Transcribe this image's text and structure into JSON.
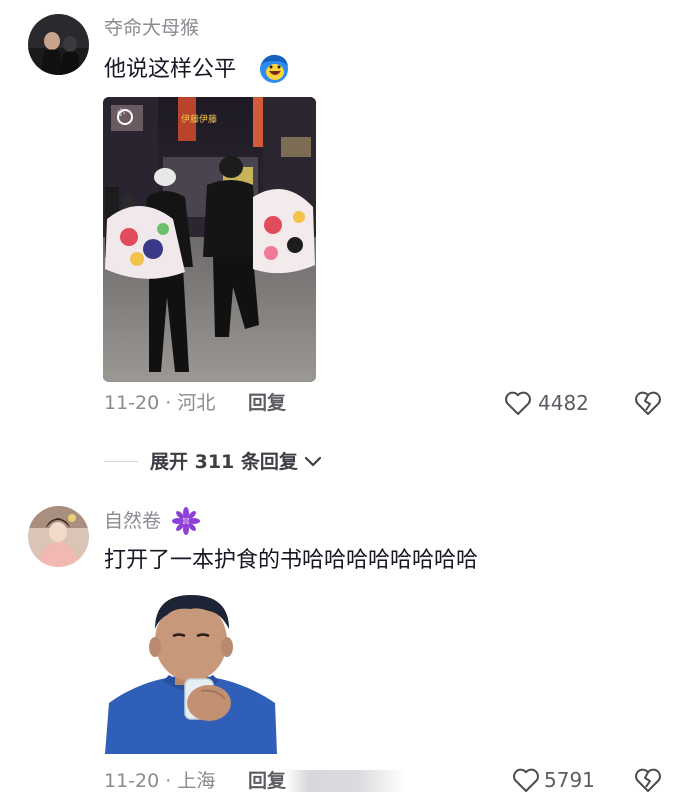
{
  "comments": [
    {
      "username": "夺命大母猴",
      "text": "他说这样公平",
      "date_location": "11-20 · 河北",
      "reply_label": "回复",
      "like_count": "4482"
    },
    {
      "username": "自然卷",
      "text": "打开了一本护食的书哈哈哈哈哈哈哈哈",
      "date_location": "11-20 · 上海",
      "reply_label": "回复",
      "like_count": "5791"
    }
  ],
  "expand_replies": {
    "label": "展开 311 条回复"
  },
  "photo_signs": {
    "sign_1": "伊藤伊藤",
    "sign_2": "小"
  },
  "icons": {
    "like": "heart-outline-icon",
    "dislike": "broken-heart-icon",
    "expand": "chevron-down-icon",
    "emoji": "laughing-emoji-icon",
    "badge": "flower-badge-icon"
  },
  "colors": {
    "username": "#8a8b91",
    "content": "#161823",
    "meta": "#8a8b91",
    "emoji_blue": "#2d8cf0",
    "badge_purple": "#8e3fd8"
  }
}
